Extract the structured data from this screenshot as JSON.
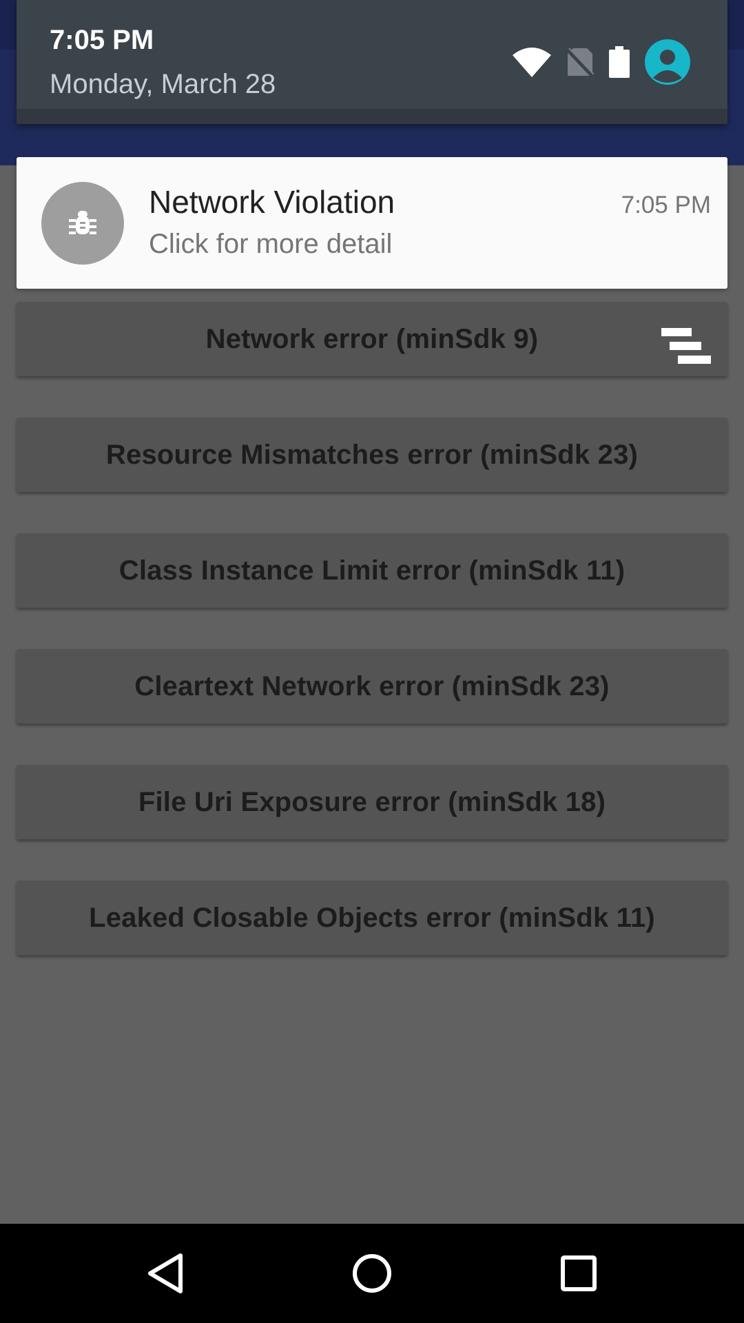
{
  "shade": {
    "time": "7:05 PM",
    "date": "Monday, March 28",
    "icons": [
      "wifi-icon",
      "no-sim-icon",
      "battery-icon",
      "user-avatar-icon"
    ]
  },
  "notification": {
    "icon": "bug-icon",
    "title": "Network Violation",
    "subtitle": "Click for more detail",
    "time": "7:05 PM"
  },
  "buttons": [
    {
      "label": "Network error (minSdk 9)"
    },
    {
      "label": "Resource Mismatches error (minSdk 23)"
    },
    {
      "label": "Class Instance Limit error (minSdk 11)"
    },
    {
      "label": "Cleartext Network error (minSdk 23)"
    },
    {
      "label": "File Uri Exposure error (minSdk 18)"
    },
    {
      "label": "Leaked Closable Objects error (minSdk 11)"
    }
  ],
  "navbar": {
    "icons": [
      "back-icon",
      "home-icon",
      "recents-icon"
    ]
  },
  "colors": {
    "accent": "#17b6c9",
    "app_bar": "#1f2a5c",
    "shade": "#3b434b",
    "background_dim": "#616161"
  }
}
